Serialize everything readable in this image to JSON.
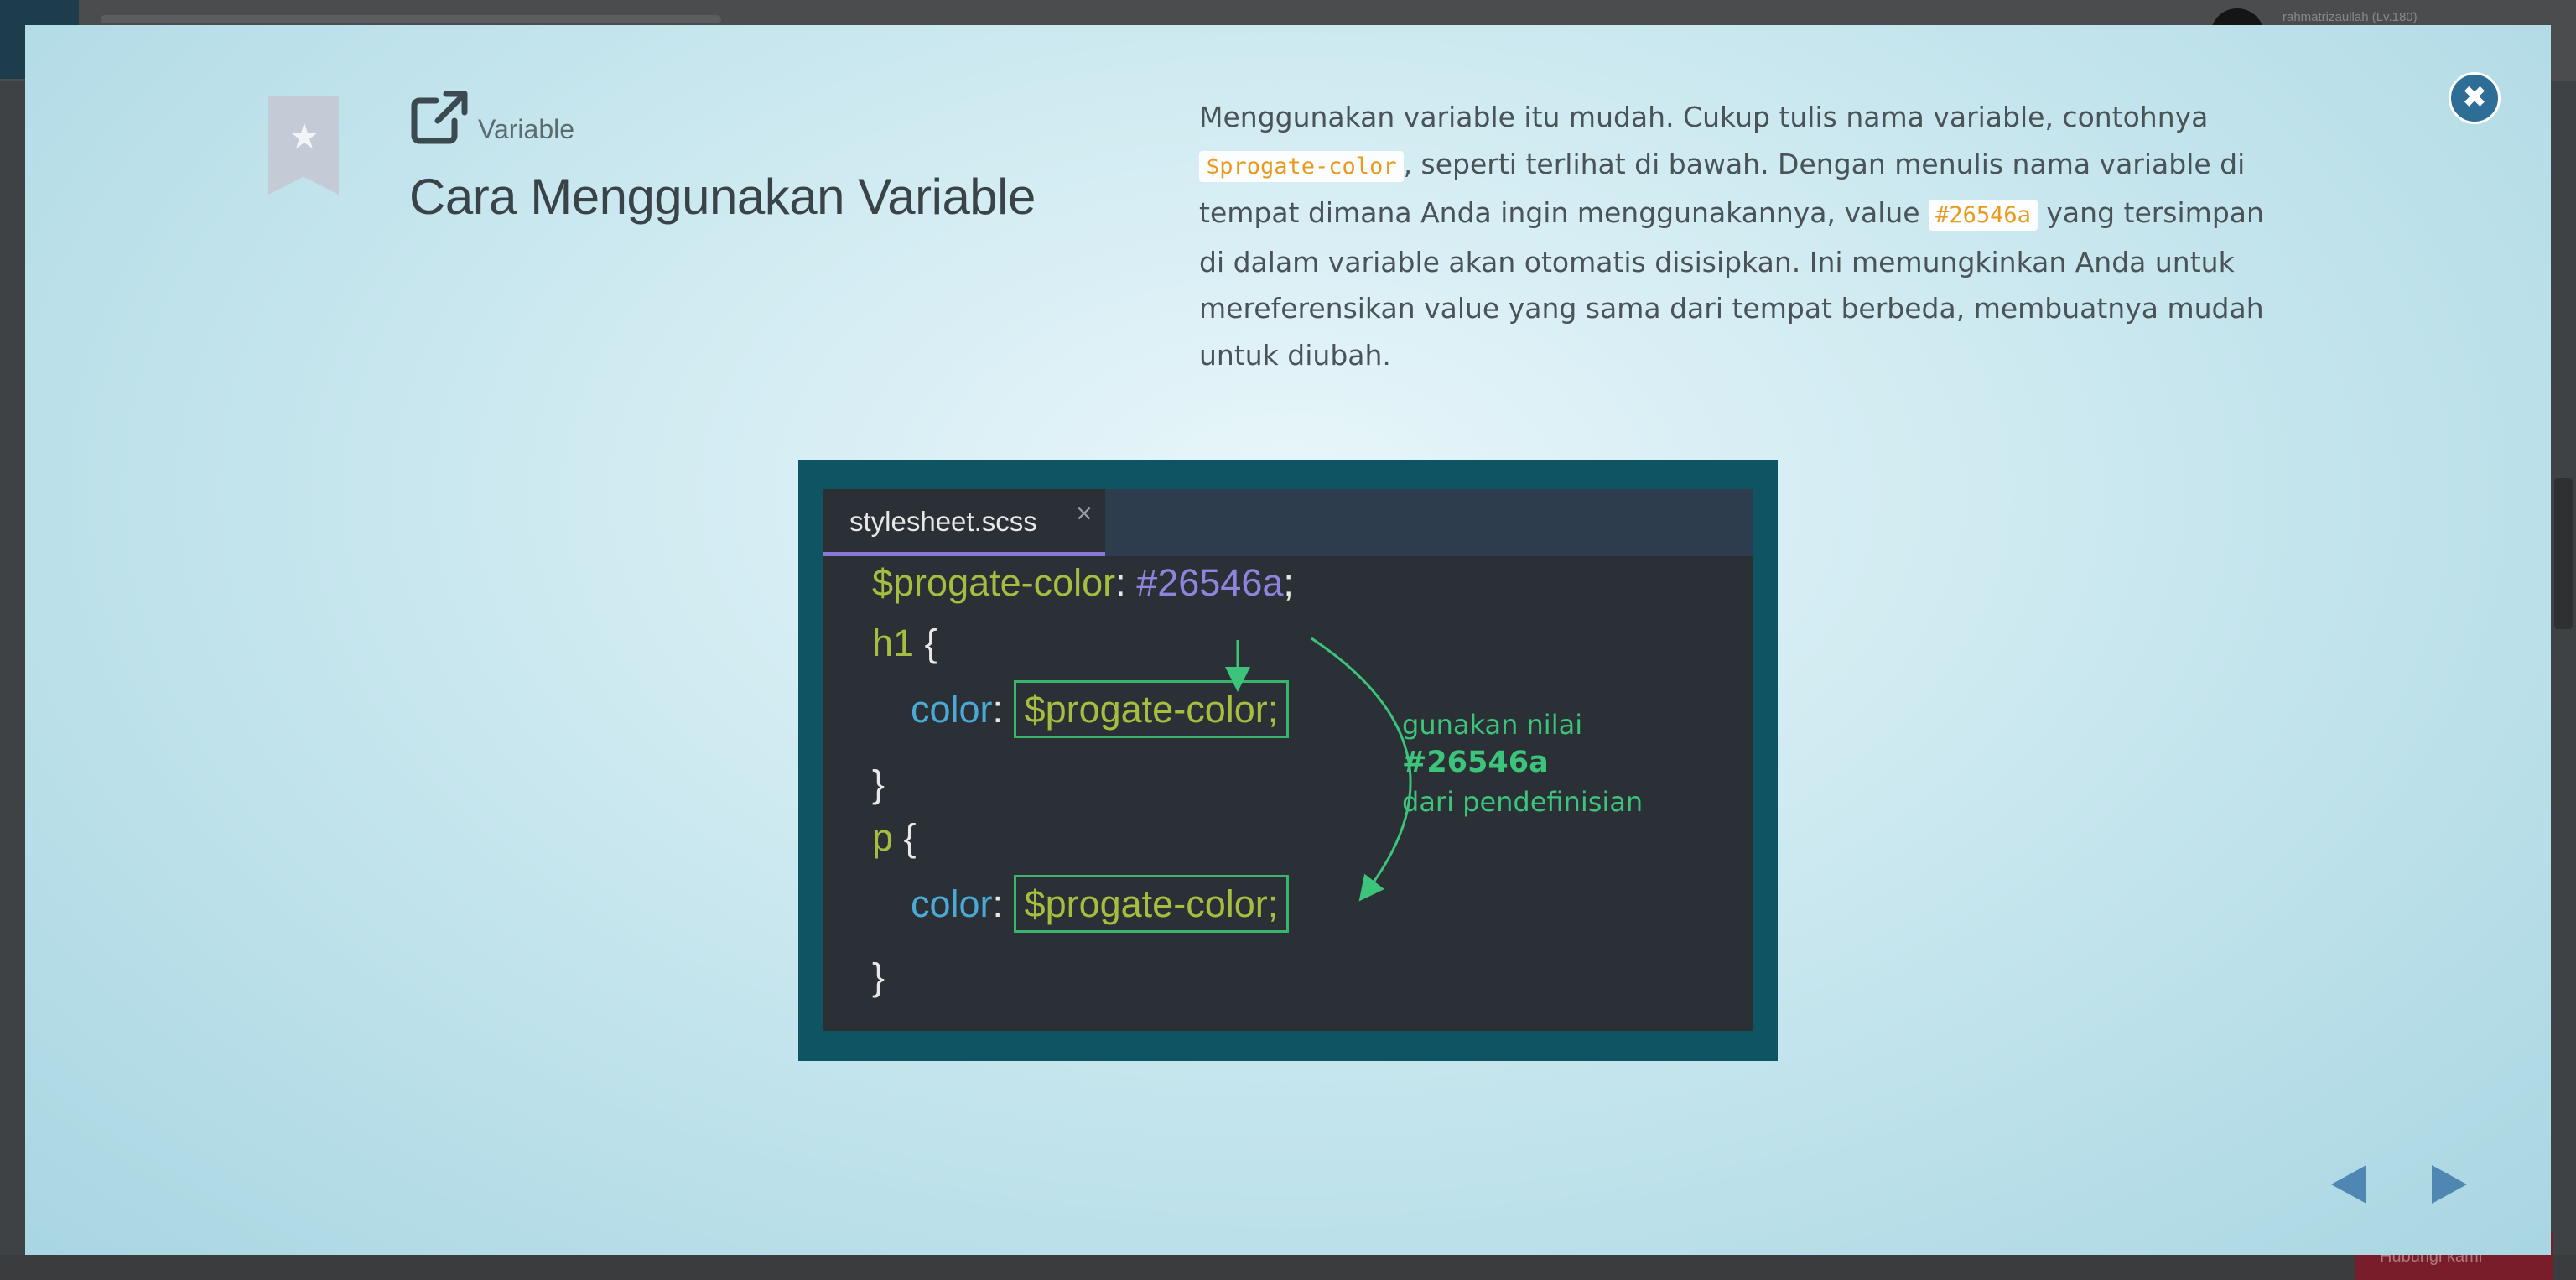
{
  "background": {
    "username": "rahmatrizaullah (Lv.180)",
    "red_button_label": "Hubungi kami"
  },
  "header": {
    "category": "Variable",
    "title": "Cara Menggunakan Variable"
  },
  "description": {
    "part1": "Menggunakan variable itu mudah. Cukup tulis nama variable, contohnya ",
    "code1": "$progate-color",
    "part2": ", seperti terlihat di bawah. Dengan menulis nama variable di tempat dimana Anda ingin menggunakannya, value ",
    "code2": "#26546a",
    "part3": " yang tersimpan di dalam variable akan otomatis disisipkan. Ini memungkinkan Anda untuk mereferensikan value yang sama dari tempat berbeda, membuatnya mudah untuk diubah."
  },
  "close": {
    "icon": "close-icon",
    "label": "✖"
  },
  "figure": {
    "tab_label": "stylesheet.scss",
    "tab_close": "×",
    "line1_var": "$progate-color",
    "line1_colon": ": ",
    "line1_hex": "#26546a",
    "line1_semi": ";",
    "line2_selector": "h1",
    "line2_brace": " {",
    "line3_prop": "color",
    "line3_colon": ": ",
    "line3_value": "$progate-color;",
    "line4_close": "}",
    "line5_selector": "p",
    "line5_brace": " {",
    "line6_prop": "color",
    "line6_colon": ": ",
    "line6_value": "$progate-color;",
    "line7_close": "}",
    "annotation_line1": "gunakan nilai",
    "annotation_line2": "#26546a",
    "annotation_line3": "dari pendefinisian",
    "colors": {
      "frame": "#0e5463",
      "editor_bg": "#2b3036",
      "variable": "#a5be3f",
      "hex_value": "#8f84dc",
      "property": "#4ba9d6",
      "annotation": "#3cc47a"
    }
  },
  "navigation": {
    "prev_icon": "triangle-left-icon",
    "next_icon": "triangle-right-icon"
  }
}
